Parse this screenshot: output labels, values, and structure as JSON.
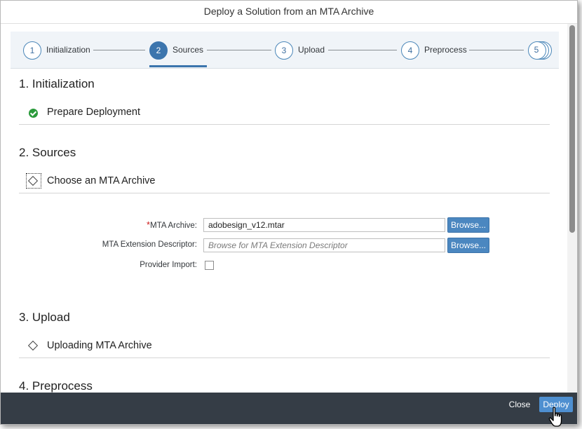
{
  "dialog": {
    "title": "Deploy a Solution from an MTA Archive"
  },
  "wizard": {
    "steps": [
      {
        "number": "1",
        "label": "Initialization"
      },
      {
        "number": "2",
        "label": "Sources"
      },
      {
        "number": "3",
        "label": "Upload"
      },
      {
        "number": "4",
        "label": "Preprocess"
      },
      {
        "number": "5",
        "label": ""
      }
    ],
    "active_step": 2
  },
  "sections": {
    "initialization": {
      "title": "1. Initialization",
      "task": {
        "label": "Prepare Deployment",
        "icon": "check-circle-icon",
        "status_color": "#2b9a3b"
      }
    },
    "sources": {
      "title": "2. Sources",
      "task": {
        "label": "Choose an MTA Archive",
        "icon": "diamond-icon"
      },
      "form": {
        "mta_archive": {
          "required_mark": "*",
          "label": "MTA Archive:",
          "value": "adobesign_v12.mtar",
          "browse_label": "Browse..."
        },
        "extension_descriptor": {
          "label": "MTA Extension Descriptor:",
          "placeholder": "Browse for MTA Extension Descriptor",
          "browse_label": "Browse..."
        },
        "provider_import": {
          "label": "Provider Import:",
          "checked": false
        }
      }
    },
    "upload": {
      "title": "3. Upload",
      "task": {
        "label": "Uploading MTA Archive",
        "icon": "diamond-icon"
      }
    },
    "preprocess": {
      "title": "4. Preprocess"
    }
  },
  "footer": {
    "close_label": "Close",
    "deploy_label": "Deploy"
  },
  "colors": {
    "accent": "#3c75ad",
    "footer_bg": "#353d46",
    "required": "#cc1919"
  }
}
